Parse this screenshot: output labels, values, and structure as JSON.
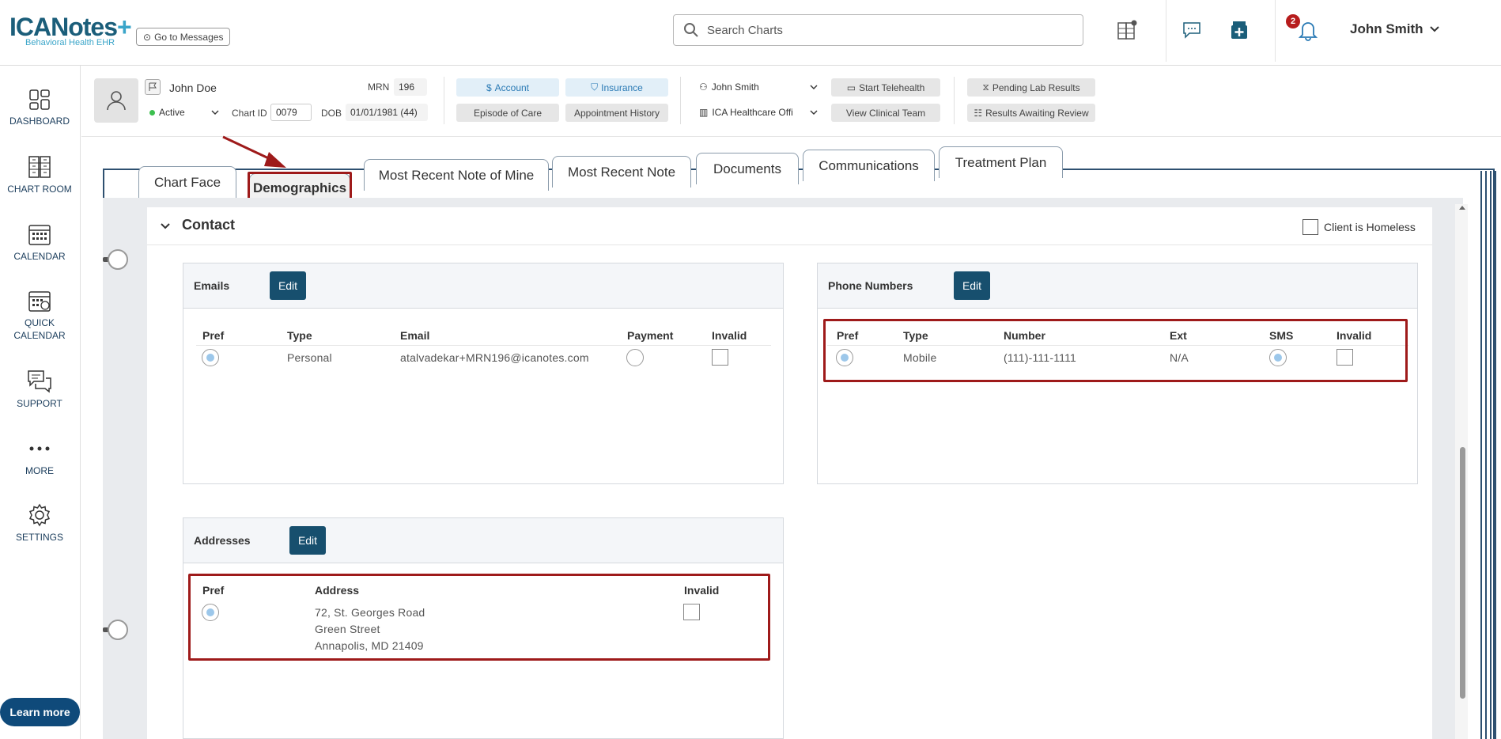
{
  "header": {
    "logo_text": "ICANotes",
    "logo_plus": "+",
    "logo_subtitle": "Behavioral Health EHR",
    "goto_messages": "Go to Messages",
    "search_placeholder": "Search Charts",
    "notification_count": "2",
    "user_name": "John Smith"
  },
  "sidebar": {
    "items": [
      {
        "label": "DASHBOARD",
        "icon": "dashboard-icon"
      },
      {
        "label": "CHART ROOM",
        "icon": "chart-room-icon"
      },
      {
        "label": "CALENDAR",
        "icon": "calendar-icon"
      },
      {
        "label_line1": "QUICK",
        "label_line2": "CALENDAR",
        "icon": "quick-calendar-icon"
      },
      {
        "label": "SUPPORT",
        "icon": "support-icon"
      },
      {
        "label": "MORE",
        "icon": "more-icon"
      },
      {
        "label": "SETTINGS",
        "icon": "gear-icon"
      }
    ],
    "learn_more": "Learn more"
  },
  "patient": {
    "name": "John Doe",
    "mrn_label": "MRN",
    "mrn": "196",
    "status": "Active",
    "chart_id_label": "Chart ID",
    "chart_id": "0079",
    "dob_label": "DOB",
    "dob": "01/01/1981 (44)",
    "buttons": {
      "account": "Account",
      "insurance": "Insurance",
      "episode_of_care": "Episode of Care",
      "appointment_history": "Appointment History",
      "provider": "John Smith",
      "facility": "ICA Healthcare Offi",
      "start_telehealth": "Start Telehealth",
      "view_clinical_team": "View Clinical Team",
      "pending_lab_results": "Pending Lab Results",
      "results_awaiting_review": "Results Awaiting Review"
    }
  },
  "tabs": [
    {
      "label": "Chart Face"
    },
    {
      "label": "Demographics",
      "active": true
    },
    {
      "label": "Most Recent Note of Mine"
    },
    {
      "label": "Most Recent Note"
    },
    {
      "label": "Documents"
    },
    {
      "label": "Communications"
    },
    {
      "label": "Treatment Plan"
    }
  ],
  "contact": {
    "title": "Contact",
    "homeless_label": "Client is Homeless",
    "homeless_checked": false,
    "emails": {
      "title": "Emails",
      "edit": "Edit",
      "columns": [
        "Pref",
        "Type",
        "Email",
        "Payment",
        "Invalid"
      ],
      "rows": [
        {
          "pref": true,
          "type": "Personal",
          "email": "atalvadekar+MRN196@icanotes.com",
          "payment": false,
          "invalid": false
        }
      ]
    },
    "phones": {
      "title": "Phone Numbers",
      "edit": "Edit",
      "columns": [
        "Pref",
        "Type",
        "Number",
        "Ext",
        "SMS",
        "Invalid"
      ],
      "rows": [
        {
          "pref": true,
          "type": "Mobile",
          "number": "(111)-111-1111",
          "ext": "N/A",
          "sms": true,
          "invalid": false
        }
      ]
    },
    "addresses": {
      "title": "Addresses",
      "edit": "Edit",
      "columns": [
        "Pref",
        "Address",
        "Invalid"
      ],
      "rows": [
        {
          "pref": true,
          "line1": "72, St. Georges Road",
          "line2": "Green Street",
          "line3": "Annapolis, MD 21409",
          "invalid": false
        }
      ]
    }
  },
  "colors": {
    "brand_dark": "#174f6e",
    "highlight_red": "#9e1a1a",
    "binder_blue": "#2e5070"
  }
}
